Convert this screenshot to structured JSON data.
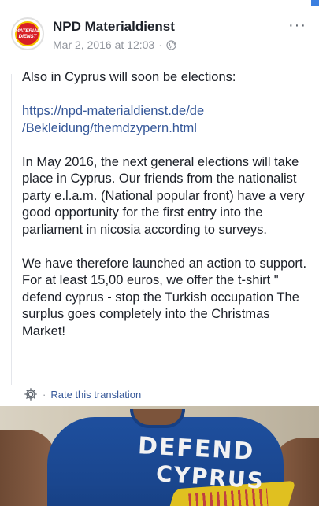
{
  "header": {
    "page_name": "NPD Materialdienst",
    "timestamp": "Mar 2, 2016 at 12:03",
    "separator": "·",
    "more_label": "···",
    "avatar_text": [
      "MATERIAL",
      "DIENST"
    ]
  },
  "post": {
    "paragraph_1": "Also in Cyprus will soon be elections:",
    "link_line_1": "https://npd-materialdienst.de/de",
    "link_line_2": "/Bekleidung/themdzypern.html",
    "paragraph_3": "In May 2016, the next general elections will take place in Cyprus. Our friends from the nationalist party e.l.a.m. (National popular front) have a very good opportunity for the first entry into the parliament in nicosia according to surveys.",
    "paragraph_4": "We have therefore launched an action to support. For at least 15,00 euros, we offer the t-shirt \" defend cyprus - stop the Turkish occupation The surplus goes completely into the Christmas Market!"
  },
  "translation": {
    "separator": "·",
    "rate_label": "Rate this translation"
  },
  "photo": {
    "shirt_line_1": "DEFEND",
    "shirt_line_2": "CYPRUS"
  },
  "icons": {
    "globe": "globe-icon",
    "gear": "gear-icon",
    "more": "more-icon"
  },
  "colors": {
    "link": "#365899",
    "meta": "#90949c",
    "text": "#1d2129",
    "badge_red": "#d81f26",
    "shirt_blue": "#1e4f9e"
  }
}
